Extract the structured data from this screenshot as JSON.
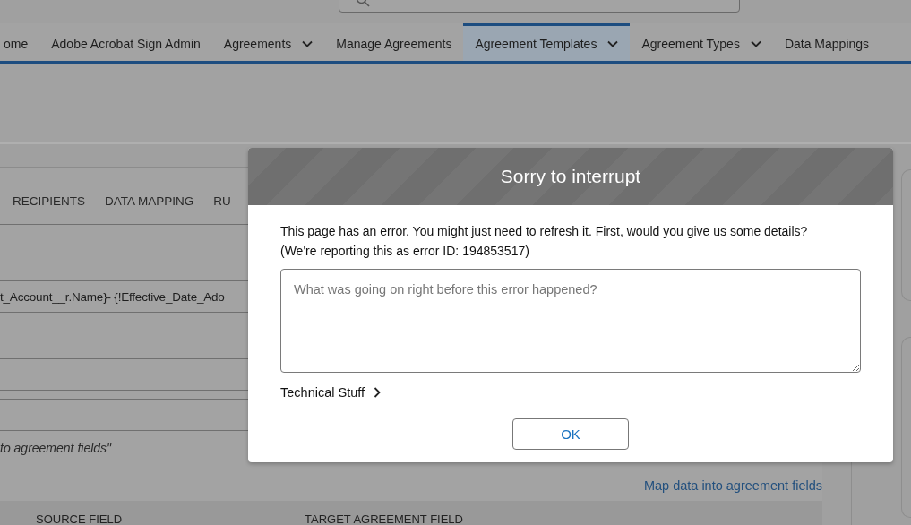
{
  "nav": {
    "items": [
      {
        "label": "ome",
        "dropdown": false,
        "selected": false
      },
      {
        "label": "Adobe Acrobat Sign Admin",
        "dropdown": false,
        "selected": false
      },
      {
        "label": "Agreements",
        "dropdown": true,
        "selected": false
      },
      {
        "label": "Manage Agreements",
        "dropdown": false,
        "selected": false
      },
      {
        "label": "Agreement Templates",
        "dropdown": true,
        "selected": true
      },
      {
        "label": "Agreement Types",
        "dropdown": true,
        "selected": false
      },
      {
        "label": "Data Mappings",
        "dropdown": false,
        "selected": false
      }
    ]
  },
  "record_tabs": [
    {
      "label": "RECIPIENTS"
    },
    {
      "label": "DATA MAPPING"
    },
    {
      "label": "RU"
    }
  ],
  "form": {
    "name_value": "t_Account__r.Name}- {!Effective_Date_Ado",
    "hint": "to agreement fields\""
  },
  "link": "Map data into agreement fields",
  "table": {
    "columns": [
      "SOURCE FIELD",
      "TARGET AGREEMENT FIELD"
    ]
  },
  "dialog": {
    "title": "Sorry to interrupt",
    "message": [
      "This page has an error. You might just need to refresh it. First, would you give us some details?",
      "(We're reporting this as error ID: 194853517)"
    ],
    "textarea": {
      "placeholder": "What was going on right before this error happened?"
    },
    "details_toggle": {
      "label": "Technical Stuff",
      "expanded": false
    },
    "buttons": [
      {
        "label": "OK"
      }
    ]
  }
}
